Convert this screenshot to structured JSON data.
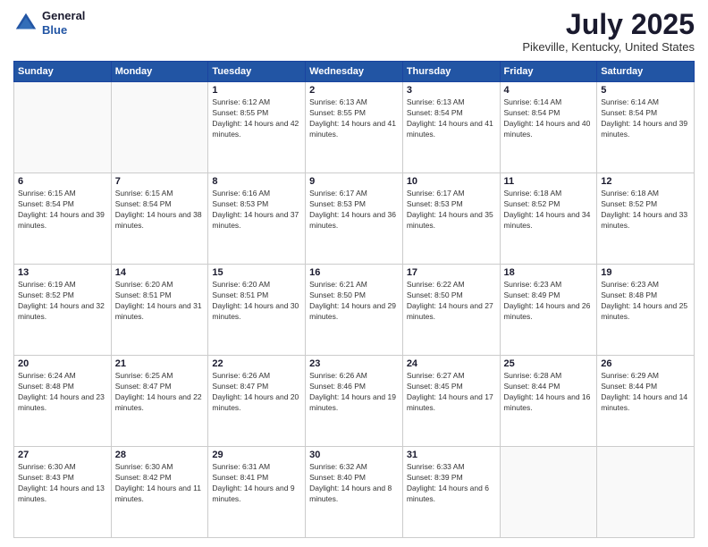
{
  "header": {
    "logo_general": "General",
    "logo_blue": "Blue",
    "month_title": "July 2025",
    "location": "Pikeville, Kentucky, United States"
  },
  "days_of_week": [
    "Sunday",
    "Monday",
    "Tuesday",
    "Wednesday",
    "Thursday",
    "Friday",
    "Saturday"
  ],
  "weeks": [
    [
      {
        "day": "",
        "sunrise": "",
        "sunset": "",
        "daylight": ""
      },
      {
        "day": "",
        "sunrise": "",
        "sunset": "",
        "daylight": ""
      },
      {
        "day": "1",
        "sunrise": "Sunrise: 6:12 AM",
        "sunset": "Sunset: 8:55 PM",
        "daylight": "Daylight: 14 hours and 42 minutes."
      },
      {
        "day": "2",
        "sunrise": "Sunrise: 6:13 AM",
        "sunset": "Sunset: 8:55 PM",
        "daylight": "Daylight: 14 hours and 41 minutes."
      },
      {
        "day": "3",
        "sunrise": "Sunrise: 6:13 AM",
        "sunset": "Sunset: 8:54 PM",
        "daylight": "Daylight: 14 hours and 41 minutes."
      },
      {
        "day": "4",
        "sunrise": "Sunrise: 6:14 AM",
        "sunset": "Sunset: 8:54 PM",
        "daylight": "Daylight: 14 hours and 40 minutes."
      },
      {
        "day": "5",
        "sunrise": "Sunrise: 6:14 AM",
        "sunset": "Sunset: 8:54 PM",
        "daylight": "Daylight: 14 hours and 39 minutes."
      }
    ],
    [
      {
        "day": "6",
        "sunrise": "Sunrise: 6:15 AM",
        "sunset": "Sunset: 8:54 PM",
        "daylight": "Daylight: 14 hours and 39 minutes."
      },
      {
        "day": "7",
        "sunrise": "Sunrise: 6:15 AM",
        "sunset": "Sunset: 8:54 PM",
        "daylight": "Daylight: 14 hours and 38 minutes."
      },
      {
        "day": "8",
        "sunrise": "Sunrise: 6:16 AM",
        "sunset": "Sunset: 8:53 PM",
        "daylight": "Daylight: 14 hours and 37 minutes."
      },
      {
        "day": "9",
        "sunrise": "Sunrise: 6:17 AM",
        "sunset": "Sunset: 8:53 PM",
        "daylight": "Daylight: 14 hours and 36 minutes."
      },
      {
        "day": "10",
        "sunrise": "Sunrise: 6:17 AM",
        "sunset": "Sunset: 8:53 PM",
        "daylight": "Daylight: 14 hours and 35 minutes."
      },
      {
        "day": "11",
        "sunrise": "Sunrise: 6:18 AM",
        "sunset": "Sunset: 8:52 PM",
        "daylight": "Daylight: 14 hours and 34 minutes."
      },
      {
        "day": "12",
        "sunrise": "Sunrise: 6:18 AM",
        "sunset": "Sunset: 8:52 PM",
        "daylight": "Daylight: 14 hours and 33 minutes."
      }
    ],
    [
      {
        "day": "13",
        "sunrise": "Sunrise: 6:19 AM",
        "sunset": "Sunset: 8:52 PM",
        "daylight": "Daylight: 14 hours and 32 minutes."
      },
      {
        "day": "14",
        "sunrise": "Sunrise: 6:20 AM",
        "sunset": "Sunset: 8:51 PM",
        "daylight": "Daylight: 14 hours and 31 minutes."
      },
      {
        "day": "15",
        "sunrise": "Sunrise: 6:20 AM",
        "sunset": "Sunset: 8:51 PM",
        "daylight": "Daylight: 14 hours and 30 minutes."
      },
      {
        "day": "16",
        "sunrise": "Sunrise: 6:21 AM",
        "sunset": "Sunset: 8:50 PM",
        "daylight": "Daylight: 14 hours and 29 minutes."
      },
      {
        "day": "17",
        "sunrise": "Sunrise: 6:22 AM",
        "sunset": "Sunset: 8:50 PM",
        "daylight": "Daylight: 14 hours and 27 minutes."
      },
      {
        "day": "18",
        "sunrise": "Sunrise: 6:23 AM",
        "sunset": "Sunset: 8:49 PM",
        "daylight": "Daylight: 14 hours and 26 minutes."
      },
      {
        "day": "19",
        "sunrise": "Sunrise: 6:23 AM",
        "sunset": "Sunset: 8:48 PM",
        "daylight": "Daylight: 14 hours and 25 minutes."
      }
    ],
    [
      {
        "day": "20",
        "sunrise": "Sunrise: 6:24 AM",
        "sunset": "Sunset: 8:48 PM",
        "daylight": "Daylight: 14 hours and 23 minutes."
      },
      {
        "day": "21",
        "sunrise": "Sunrise: 6:25 AM",
        "sunset": "Sunset: 8:47 PM",
        "daylight": "Daylight: 14 hours and 22 minutes."
      },
      {
        "day": "22",
        "sunrise": "Sunrise: 6:26 AM",
        "sunset": "Sunset: 8:47 PM",
        "daylight": "Daylight: 14 hours and 20 minutes."
      },
      {
        "day": "23",
        "sunrise": "Sunrise: 6:26 AM",
        "sunset": "Sunset: 8:46 PM",
        "daylight": "Daylight: 14 hours and 19 minutes."
      },
      {
        "day": "24",
        "sunrise": "Sunrise: 6:27 AM",
        "sunset": "Sunset: 8:45 PM",
        "daylight": "Daylight: 14 hours and 17 minutes."
      },
      {
        "day": "25",
        "sunrise": "Sunrise: 6:28 AM",
        "sunset": "Sunset: 8:44 PM",
        "daylight": "Daylight: 14 hours and 16 minutes."
      },
      {
        "day": "26",
        "sunrise": "Sunrise: 6:29 AM",
        "sunset": "Sunset: 8:44 PM",
        "daylight": "Daylight: 14 hours and 14 minutes."
      }
    ],
    [
      {
        "day": "27",
        "sunrise": "Sunrise: 6:30 AM",
        "sunset": "Sunset: 8:43 PM",
        "daylight": "Daylight: 14 hours and 13 minutes."
      },
      {
        "day": "28",
        "sunrise": "Sunrise: 6:30 AM",
        "sunset": "Sunset: 8:42 PM",
        "daylight": "Daylight: 14 hours and 11 minutes."
      },
      {
        "day": "29",
        "sunrise": "Sunrise: 6:31 AM",
        "sunset": "Sunset: 8:41 PM",
        "daylight": "Daylight: 14 hours and 9 minutes."
      },
      {
        "day": "30",
        "sunrise": "Sunrise: 6:32 AM",
        "sunset": "Sunset: 8:40 PM",
        "daylight": "Daylight: 14 hours and 8 minutes."
      },
      {
        "day": "31",
        "sunrise": "Sunrise: 6:33 AM",
        "sunset": "Sunset: 8:39 PM",
        "daylight": "Daylight: 14 hours and 6 minutes."
      },
      {
        "day": "",
        "sunrise": "",
        "sunset": "",
        "daylight": ""
      },
      {
        "day": "",
        "sunrise": "",
        "sunset": "",
        "daylight": ""
      }
    ]
  ]
}
